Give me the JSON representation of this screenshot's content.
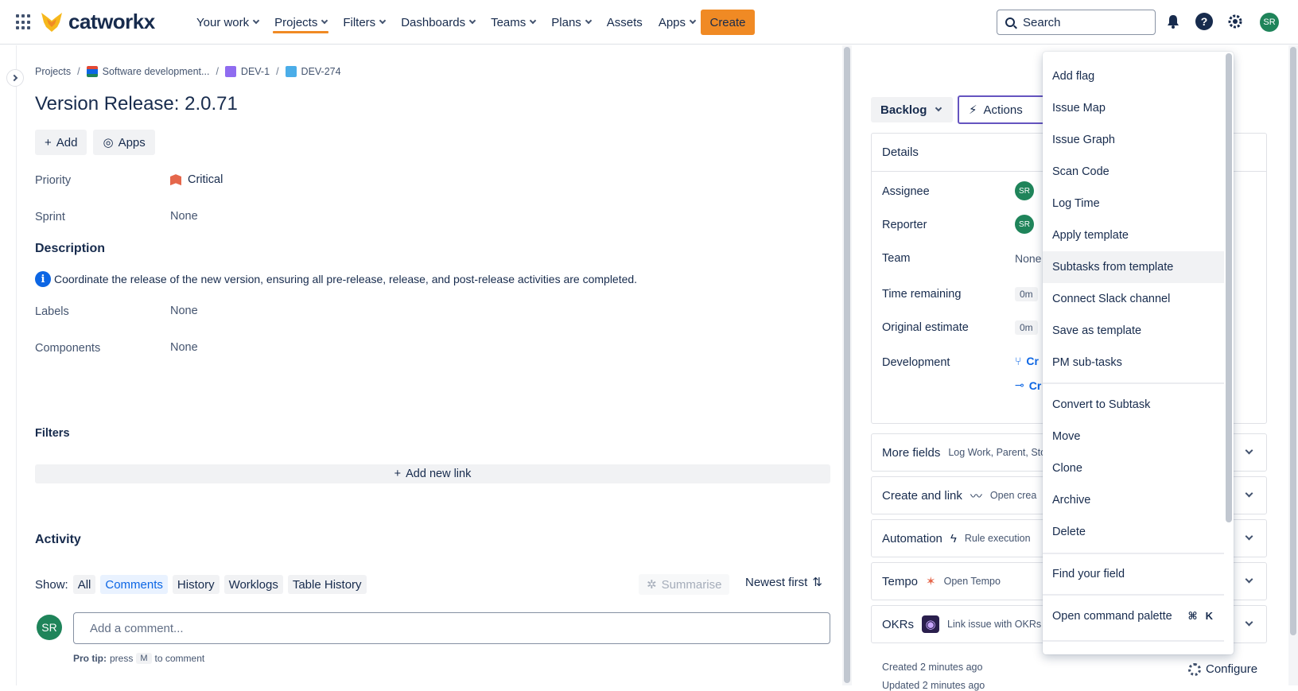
{
  "topbar": {
    "logo_text": "catworkx",
    "nav": [
      "Your work",
      "Projects",
      "Filters",
      "Dashboards",
      "Teams",
      "Plans",
      "Assets",
      "Apps"
    ],
    "create_label": "Create",
    "search_placeholder": "Search",
    "user_initials": "SR",
    "accent_color": "#f08a24"
  },
  "breadcrumb": {
    "projects": "Projects",
    "project": "Software development...",
    "epic": "DEV-1",
    "issue": "DEV-274"
  },
  "issue": {
    "title": "Version Release: 2.0.71",
    "add_label": "Add",
    "apps_label": "Apps",
    "priority_label": "Priority",
    "priority_value": "Critical",
    "sprint_label": "Sprint",
    "sprint_value": "None",
    "description_heading": "Description",
    "description_text": "Coordinate the release of the new version, ensuring all pre-release, release, and post-release activities are completed.",
    "labels_label": "Labels",
    "labels_value": "None",
    "components_label": "Components",
    "components_value": "None",
    "filters_heading": "Filters",
    "add_link_label": "Add new link"
  },
  "activity": {
    "heading": "Activity",
    "show_label": "Show:",
    "tabs": [
      "All",
      "Comments",
      "History",
      "Worklogs",
      "Table History"
    ],
    "selected_tab": "Comments",
    "summarise_label": "Summarise",
    "sort_label": "Newest first",
    "comment_placeholder": "Add a comment...",
    "protip_prefix": "Pro tip:",
    "protip_press": "press",
    "protip_key": "M",
    "protip_suffix": "to comment"
  },
  "side": {
    "status_label": "Backlog",
    "actions_label": "Actions",
    "details_heading": "Details",
    "assignee_label": "Assignee",
    "reporter_label": "Reporter",
    "team_label": "Team",
    "team_value": "None",
    "time_remaining_label": "Time remaining",
    "time_remaining_value": "0m",
    "original_estimate_label": "Original estimate",
    "original_estimate_value": "0m",
    "development_label": "Development",
    "dev_link_1": "Cr",
    "dev_link_2": "Cr",
    "more_fields_label": "More fields",
    "more_fields_sub": "Log Work, Parent, Stor",
    "create_link_label": "Create and link",
    "create_link_sub": "Open crea",
    "automation_label": "Automation",
    "automation_sub": "Rule execution",
    "tempo_label": "Tempo",
    "tempo_sub": "Open Tempo",
    "okrs_label": "OKRs",
    "okrs_sub": "Link issue with OKRs",
    "created_text": "Created 2 minutes ago",
    "updated_text": "Updated 2 minutes ago",
    "configure_label": "Configure"
  },
  "menu": {
    "items": [
      "Add flag",
      "Issue Map",
      "Issue Graph",
      "Scan Code",
      "Log Time",
      "Apply template",
      "Subtasks from template",
      "Connect Slack channel",
      "Save as template",
      "PM sub-tasks",
      "Convert to Subtask",
      "Move",
      "Clone",
      "Archive",
      "Delete",
      "Find your field",
      "Open command palette"
    ],
    "hovered": "Subtasks from template",
    "shortcut_cmd": "⌘",
    "shortcut_key": "K"
  }
}
